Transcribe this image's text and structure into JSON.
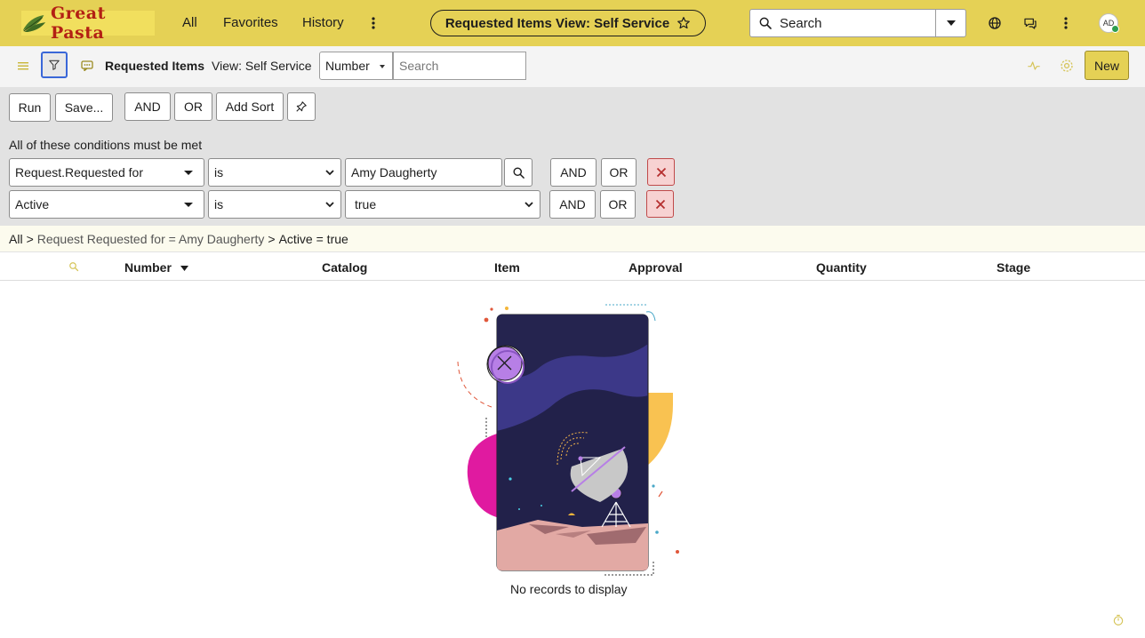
{
  "topnav": {
    "logo_text": "Great Pasta",
    "links": [
      "All",
      "Favorites",
      "History"
    ],
    "page_pill": "Requested Items View: Self Service",
    "search_label": "Search",
    "avatar_initials": "AD"
  },
  "list_header": {
    "title": "Requested Items",
    "view": "View: Self Service",
    "search_field": "Number",
    "search_placeholder": "Search",
    "new_label": "New"
  },
  "filter": {
    "run_label": "Run",
    "save_label": "Save...",
    "and_label": "AND",
    "or_label": "OR",
    "add_sort_label": "Add Sort",
    "conditions_title": "All of these conditions must be met",
    "conditions": [
      {
        "field": "Request.Requested for",
        "operator": "is",
        "value": "Amy Daugherty"
      },
      {
        "field": "Active",
        "operator": "is",
        "value": "true"
      }
    ]
  },
  "breadcrumb": {
    "items": [
      "All",
      "Request Requested for = Amy Daugherty",
      "Active = true"
    ],
    "separator": ">"
  },
  "table": {
    "columns": [
      "Number",
      "Catalog",
      "Item",
      "Approval",
      "Quantity",
      "Stage"
    ],
    "empty_message": "No records to display"
  },
  "colors": {
    "nav_bg": "#e5d155",
    "accent_blue": "#3a67d8",
    "delete_red": "#c04a4a"
  },
  "icons": {
    "logo": "leaf-logo-icon",
    "star": "star-icon",
    "search": "search-icon",
    "dropdown": "chevron-down-icon",
    "globe": "globe-icon",
    "chat": "chat-icon",
    "more": "more-vertical-icon",
    "menu": "hamburger-icon",
    "filter": "filter-icon",
    "comment": "comment-icon",
    "pulse": "activity-icon",
    "settings": "gear-icon",
    "pin": "pin-icon",
    "delete": "close-icon",
    "timer": "timer-icon"
  }
}
